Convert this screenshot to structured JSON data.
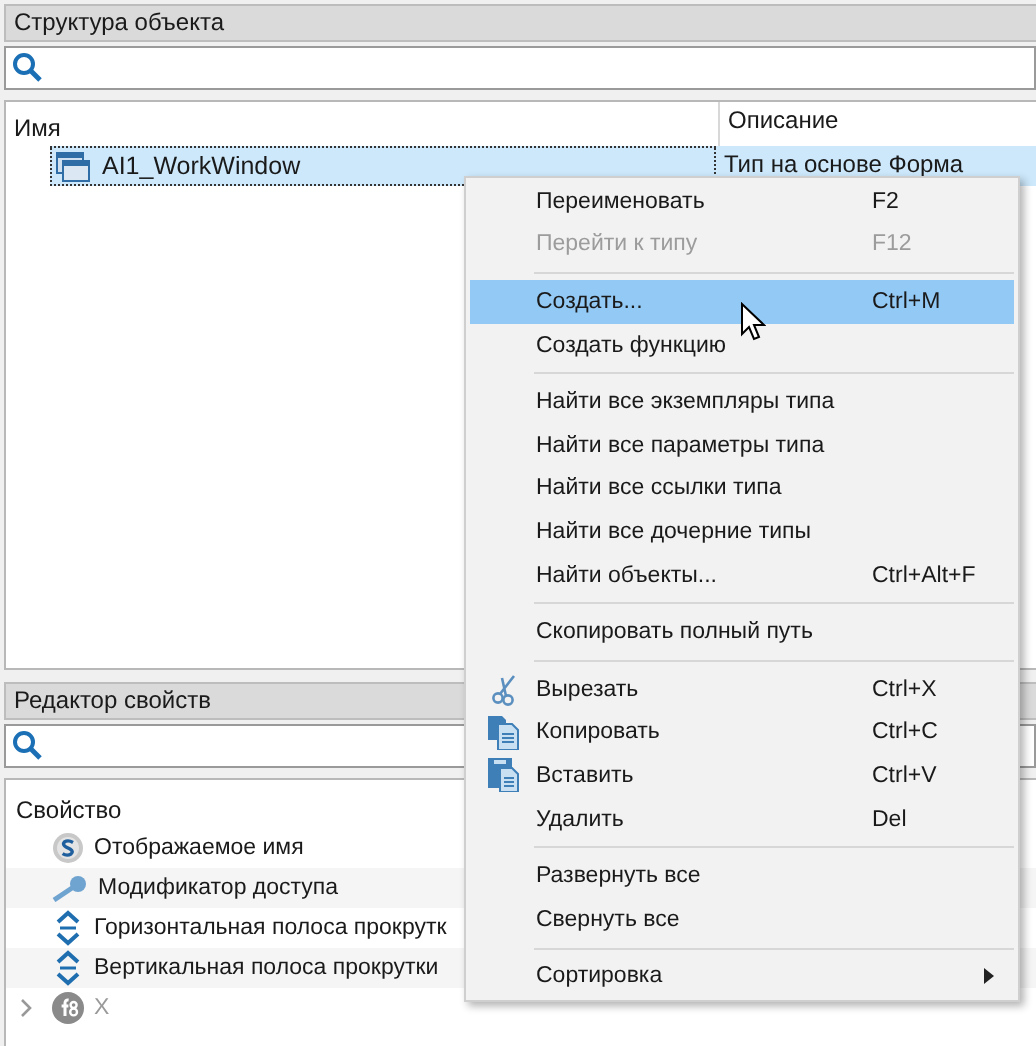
{
  "structure_panel": {
    "title": "Структура объекта",
    "columns": [
      "Имя",
      "Описание"
    ],
    "rows": [
      {
        "name": "AI1_WorkWindow",
        "description": "Тип на основе Форма",
        "selected": true
      }
    ]
  },
  "properties_panel": {
    "title": "Редактор свойств",
    "column": "Свойство",
    "rows": [
      {
        "name": "Отображаемое имя",
        "kind": "string",
        "expandable": false,
        "disabled": false
      },
      {
        "name": "Модификатор доступа",
        "kind": "access",
        "expandable": false,
        "disabled": false
      },
      {
        "name": "Горизонтальная полоса прокрутк",
        "kind": "scroll",
        "expandable": false,
        "disabled": false
      },
      {
        "name": "Вертикальная полоса прокрутки",
        "kind": "scroll",
        "expandable": false,
        "disabled": false
      },
      {
        "name": "X",
        "kind": "function",
        "expandable": true,
        "disabled": true
      }
    ]
  },
  "context_menu": [
    {
      "kind": "item",
      "label": "Переименовать",
      "shortcut": "F2",
      "disabled": false,
      "selected": false
    },
    {
      "kind": "item",
      "label": "Перейти к типу",
      "shortcut": "F12",
      "disabled": true,
      "selected": false
    },
    {
      "kind": "separator"
    },
    {
      "kind": "item",
      "label": "Создать...",
      "shortcut": "Ctrl+M",
      "disabled": false,
      "selected": true
    },
    {
      "kind": "item",
      "label": "Создать функцию",
      "disabled": false,
      "selected": false
    },
    {
      "kind": "separator"
    },
    {
      "kind": "item",
      "label": "Найти все экземпляры типа",
      "disabled": false,
      "selected": false
    },
    {
      "kind": "item",
      "label": "Найти все параметры типа",
      "disabled": false,
      "selected": false
    },
    {
      "kind": "item",
      "label": "Найти все ссылки типа",
      "disabled": false,
      "selected": false
    },
    {
      "kind": "item",
      "label": "Найти все дочерние типы",
      "disabled": false,
      "selected": false
    },
    {
      "kind": "item",
      "label": "Найти объекты...",
      "shortcut": "Ctrl+Alt+F",
      "disabled": false,
      "selected": false
    },
    {
      "kind": "separator"
    },
    {
      "kind": "item",
      "label": "Скопировать полный путь",
      "disabled": false,
      "selected": false
    },
    {
      "kind": "separator"
    },
    {
      "kind": "cut",
      "label": "Вырезать",
      "shortcut": "Ctrl+X",
      "disabled": false,
      "selected": false
    },
    {
      "kind": "copy",
      "label": "Копировать",
      "shortcut": "Ctrl+C",
      "disabled": false,
      "selected": false
    },
    {
      "kind": "paste",
      "label": "Вставить",
      "shortcut": "Ctrl+V",
      "disabled": false,
      "selected": false
    },
    {
      "kind": "item",
      "label": "Удалить",
      "shortcut": "Del",
      "disabled": false,
      "selected": false
    },
    {
      "kind": "separator"
    },
    {
      "kind": "item",
      "label": "Развернуть все",
      "disabled": false,
      "selected": false
    },
    {
      "kind": "item",
      "label": "Свернуть все",
      "disabled": false,
      "selected": false
    },
    {
      "kind": "separator"
    },
    {
      "kind": "submenu",
      "label": "Сортировка",
      "disabled": false,
      "selected": false
    }
  ]
}
